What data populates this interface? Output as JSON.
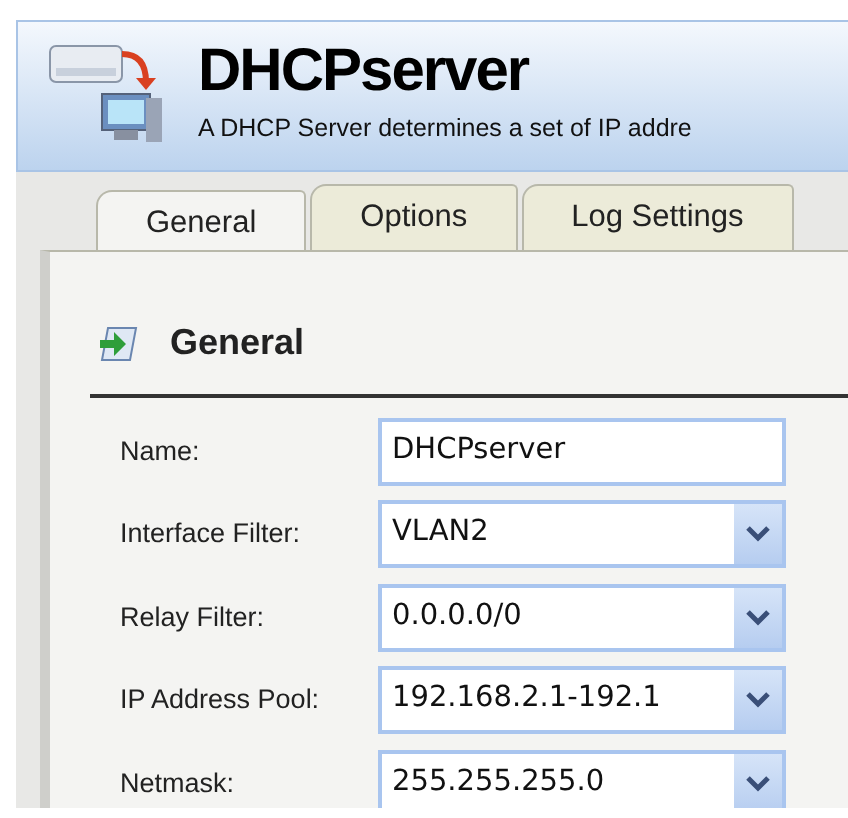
{
  "header": {
    "title": "DHCPserver",
    "description": "A DHCP Server determines a set of IP addre"
  },
  "tabs": [
    {
      "label": "General",
      "selected": true
    },
    {
      "label": "Options",
      "selected": false
    },
    {
      "label": "Log Settings",
      "selected": false
    }
  ],
  "section": {
    "title": "General"
  },
  "fields": [
    {
      "label": "Name:",
      "kind": "text",
      "value": "DHCPserver"
    },
    {
      "label": "Interface Filter:",
      "kind": "select",
      "value": "VLAN2"
    },
    {
      "label": "Relay Filter:",
      "kind": "select",
      "value": "0.0.0.0/0"
    },
    {
      "label": "IP Address Pool:",
      "kind": "select",
      "value": "192.168.2.1-192.1"
    },
    {
      "label": "Netmask:",
      "kind": "select",
      "value": "255.255.255.0"
    }
  ]
}
